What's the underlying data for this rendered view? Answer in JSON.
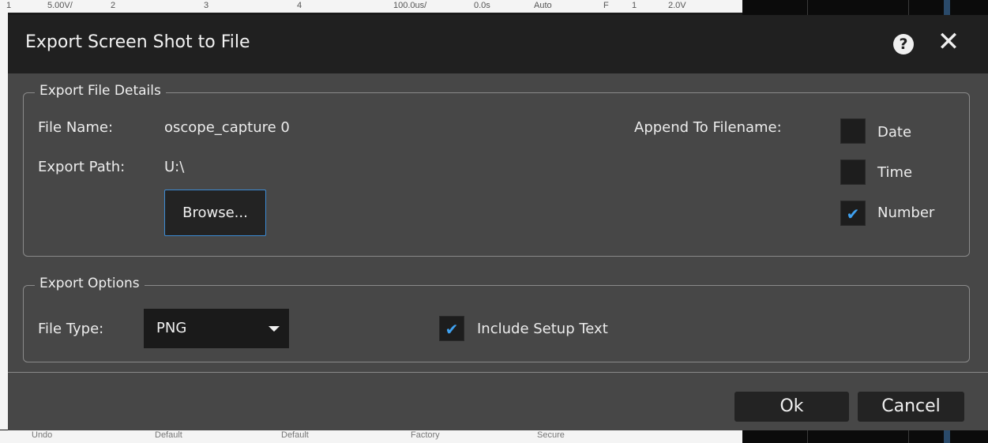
{
  "background": {
    "top_readouts": [
      "1",
      "5.00V/",
      "2",
      "3",
      "4",
      "100.0us/",
      "0.0s",
      "Auto",
      "F",
      "1",
      "2.0V"
    ],
    "bottom_labels": [
      "Undo",
      "Default",
      "Default",
      "Factory",
      "Secure"
    ]
  },
  "dialog": {
    "title": "Export Screen Shot to File",
    "help_symbol": "?",
    "close_symbol": "✕"
  },
  "file_details": {
    "group_label": "Export File Details",
    "file_name_label": "File Name:",
    "file_name_value": "oscope_capture 0",
    "export_path_label": "Export Path:",
    "export_path_value": "U:\\",
    "browse_label": "Browse...",
    "append_label": "Append To Filename:",
    "append_options": [
      {
        "label": "Date",
        "checked": false
      },
      {
        "label": "Time",
        "checked": false
      },
      {
        "label": "Number",
        "checked": true
      }
    ]
  },
  "export_options": {
    "group_label": "Export Options",
    "file_type_label": "File Type:",
    "file_type_value": "PNG",
    "include_setup_label": "Include Setup Text",
    "include_setup_checked": true
  },
  "footer": {
    "ok_label": "Ok",
    "cancel_label": "Cancel"
  },
  "colors": {
    "dialog_bg": "#474747",
    "titlebar_bg": "#202020",
    "accent": "#3fa1f0"
  }
}
